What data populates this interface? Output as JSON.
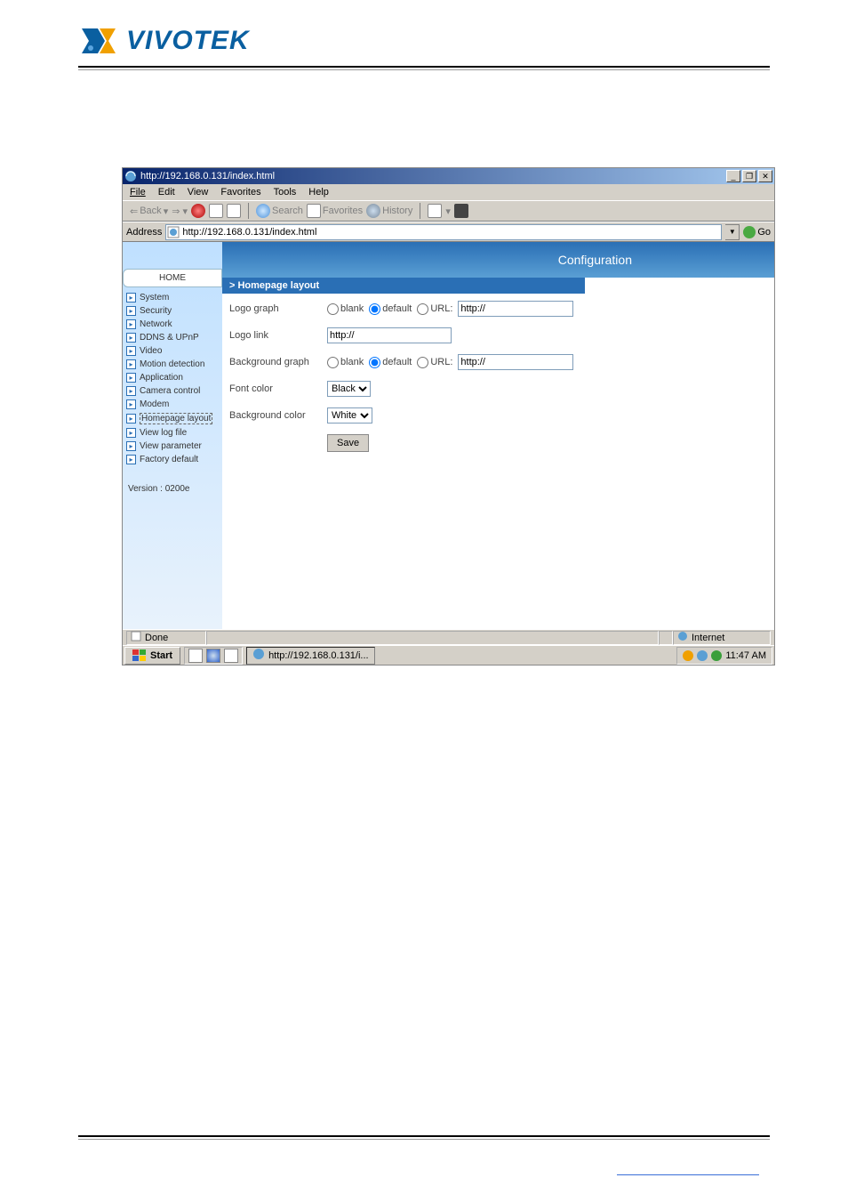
{
  "brand": {
    "name": "VIVOTEK",
    "accent": "#0a5fa0"
  },
  "window": {
    "title": "http://192.168.0.131/index.html",
    "menu": [
      "File",
      "Edit",
      "View",
      "Favorites",
      "Tools",
      "Help"
    ],
    "toolbar": {
      "back": "Back",
      "search": "Search",
      "favorites": "Favorites",
      "history": "History"
    },
    "addressLabel": "Address",
    "addressValue": "http://192.168.0.131/index.html",
    "goLabel": "Go"
  },
  "config": {
    "heading": "Configuration",
    "panelTitle": "> Homepage layout",
    "rows": {
      "logoGraph": {
        "label": "Logo graph",
        "optBlank": "blank",
        "optDefault": "default",
        "optUrl": "URL:",
        "urlValue": "http://"
      },
      "logoLink": {
        "label": "Logo link",
        "value": "http://"
      },
      "bgGraph": {
        "label": "Background graph",
        "optBlank": "blank",
        "optDefault": "default",
        "optUrl": "URL:",
        "urlValue": "http://"
      },
      "fontColor": {
        "label": "Font color",
        "value": "Black"
      },
      "bgColor": {
        "label": "Background color",
        "value": "White"
      }
    },
    "saveLabel": "Save"
  },
  "sidebar": {
    "home": "HOME",
    "items": [
      "System",
      "Security",
      "Network",
      "DDNS & UPnP",
      "Video",
      "Motion detection",
      "Application",
      "Camera control",
      "Modem",
      "Homepage layout",
      "View log file",
      "View parameter",
      "Factory default"
    ],
    "activeIndex": 9,
    "version": "Version : 0200e"
  },
  "status": {
    "done": "Done",
    "zone": "Internet"
  },
  "taskbar": {
    "start": "Start",
    "task": "http://192.168.0.131/i...",
    "time": "11:47 AM"
  }
}
